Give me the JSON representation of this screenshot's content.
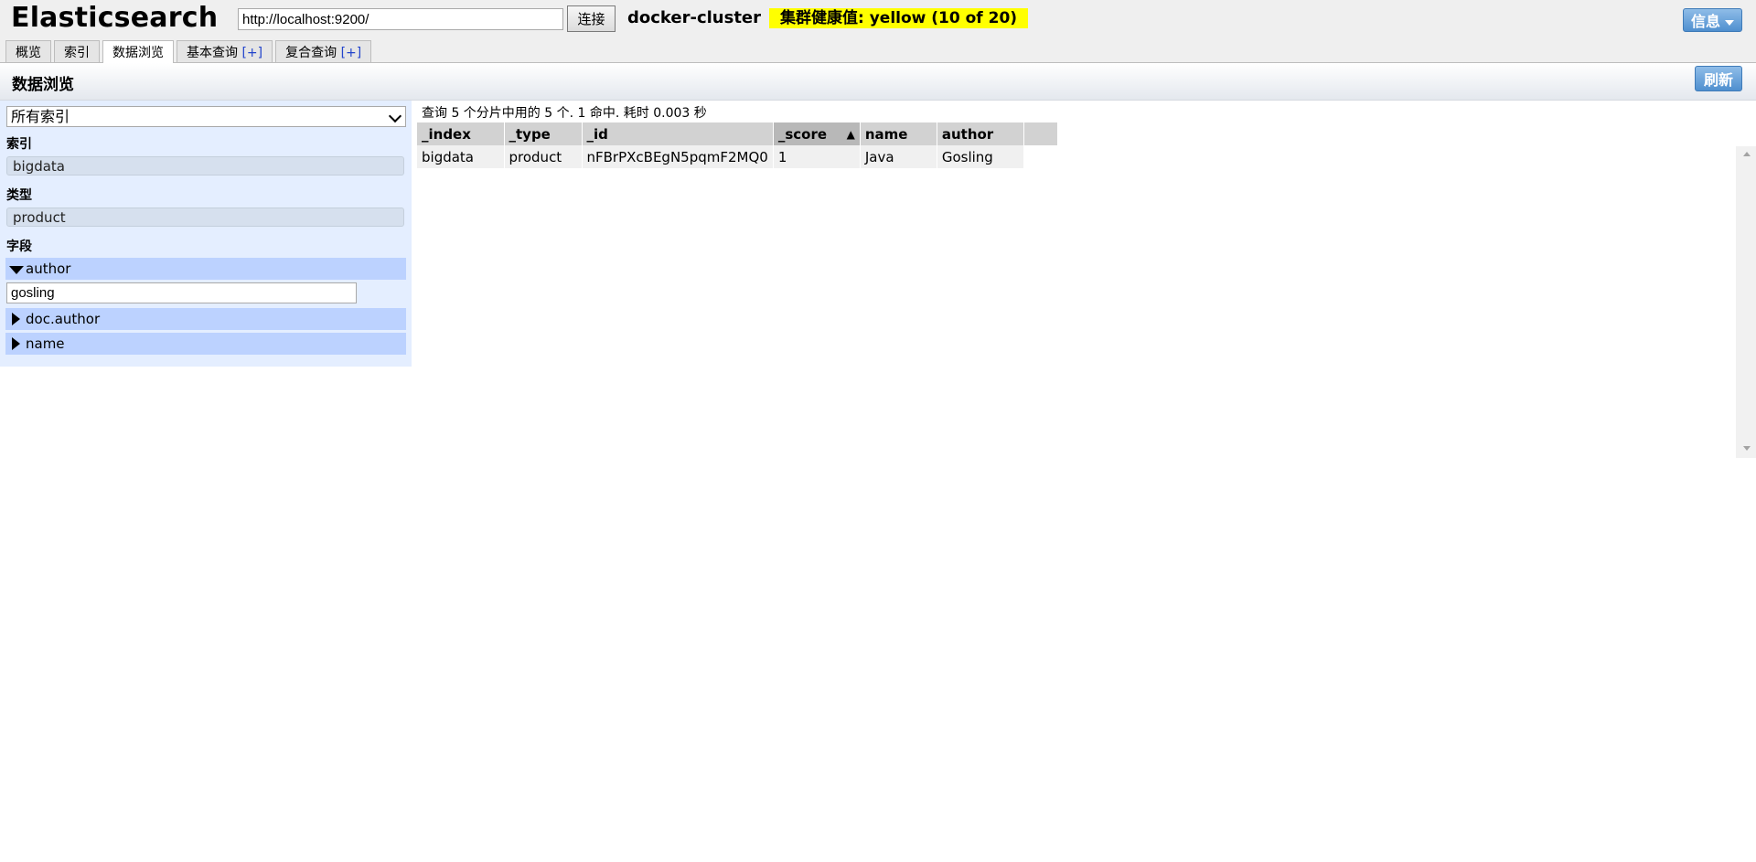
{
  "header": {
    "title": "Elasticsearch",
    "url": "http://localhost:9200/",
    "connect_label": "连接",
    "cluster_name": "docker-cluster",
    "health": "集群健康值: yellow (10 of 20)",
    "info_label": "信息",
    "health_color": "#ffff00"
  },
  "tabs": [
    {
      "label": "概览",
      "plus": ""
    },
    {
      "label": "索引",
      "plus": ""
    },
    {
      "label": "数据浏览",
      "plus": ""
    },
    {
      "label": "基本查询",
      "plus": "[+]"
    },
    {
      "label": "复合查询",
      "plus": "[+]"
    }
  ],
  "page": {
    "title": "数据浏览",
    "refresh_label": "刷新"
  },
  "sidebar": {
    "index_select": "所有索引",
    "index_label": "索引",
    "index_value": "bigdata",
    "type_label": "类型",
    "type_value": "product",
    "fields_label": "字段",
    "fields": [
      {
        "name": "author",
        "expanded": true,
        "filter_value": "gosling"
      },
      {
        "name": "doc.author",
        "expanded": false
      },
      {
        "name": "name",
        "expanded": false
      }
    ]
  },
  "results": {
    "summary": "查询 5 个分片中用的 5 个. 1 命中. 耗时 0.003 秒",
    "columns": [
      "_index",
      "_type",
      "_id",
      "_score",
      "name",
      "author"
    ],
    "sorted_column": "_score",
    "sort_arrow": "▲",
    "rows": [
      [
        "bigdata",
        "product",
        "nFBrPXcBEgN5pqmF2MQ0",
        "1",
        "Java",
        "Gosling"
      ]
    ]
  }
}
